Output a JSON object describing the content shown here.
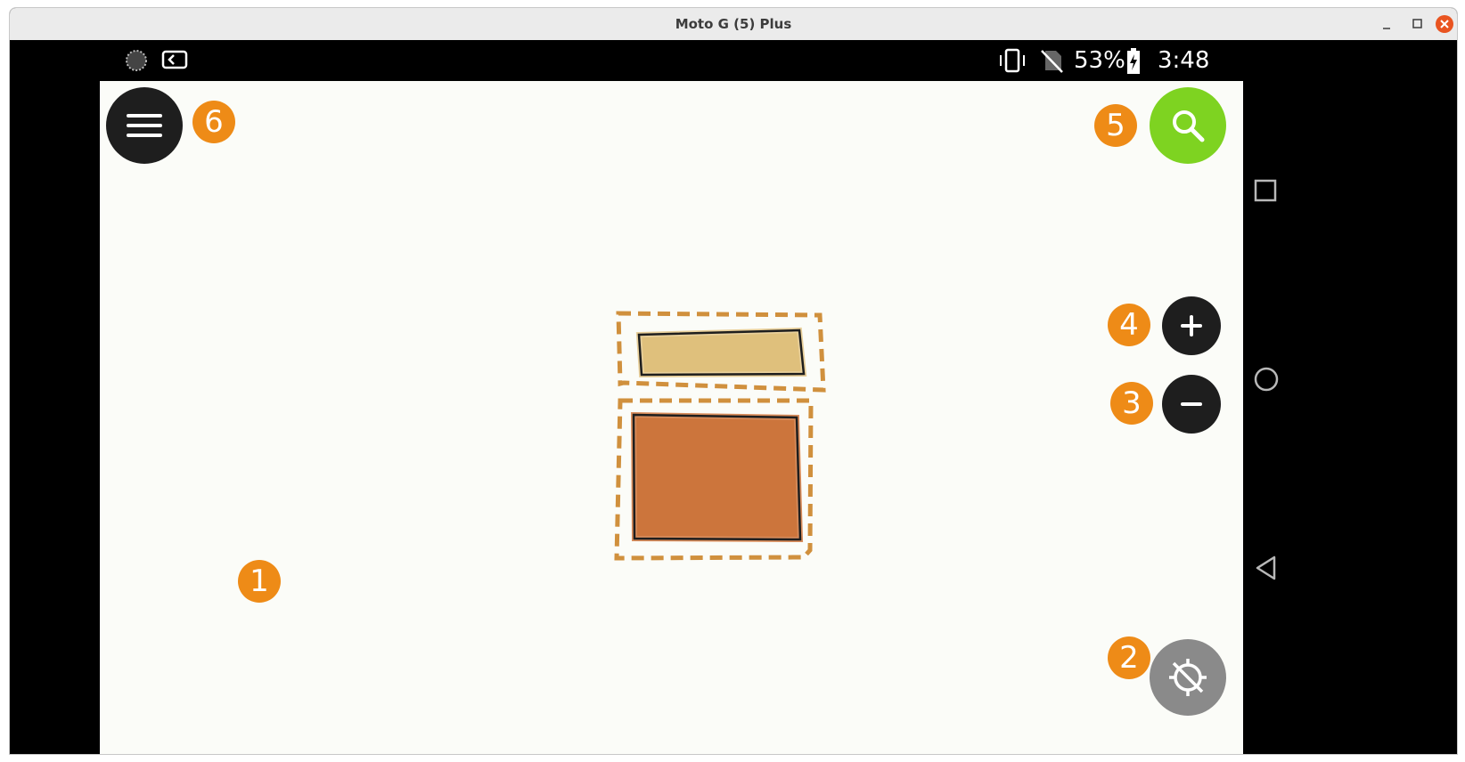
{
  "window": {
    "title": "Moto G (5) Plus"
  },
  "statusbar": {
    "battery": "53%",
    "time": "3:48"
  },
  "map": {
    "shapes": [
      {
        "name": "area-small",
        "fill": "#dfc07c"
      },
      {
        "name": "area-large",
        "fill": "#cc753c"
      }
    ],
    "accent_outline": "#d0903d"
  },
  "controls": {
    "menu_icon": "hamburger-icon",
    "search_icon": "search-icon",
    "zoom_in_icon": "plus-icon",
    "zoom_out_icon": "minus-icon",
    "location_icon": "location-off-icon",
    "search_color": "#7ed321",
    "dark_color": "#1e1e1e",
    "location_color": "#8a8a8a"
  },
  "badges": [
    "1",
    "2",
    "3",
    "4",
    "5",
    "6"
  ],
  "badge_color": "#ee8b17"
}
